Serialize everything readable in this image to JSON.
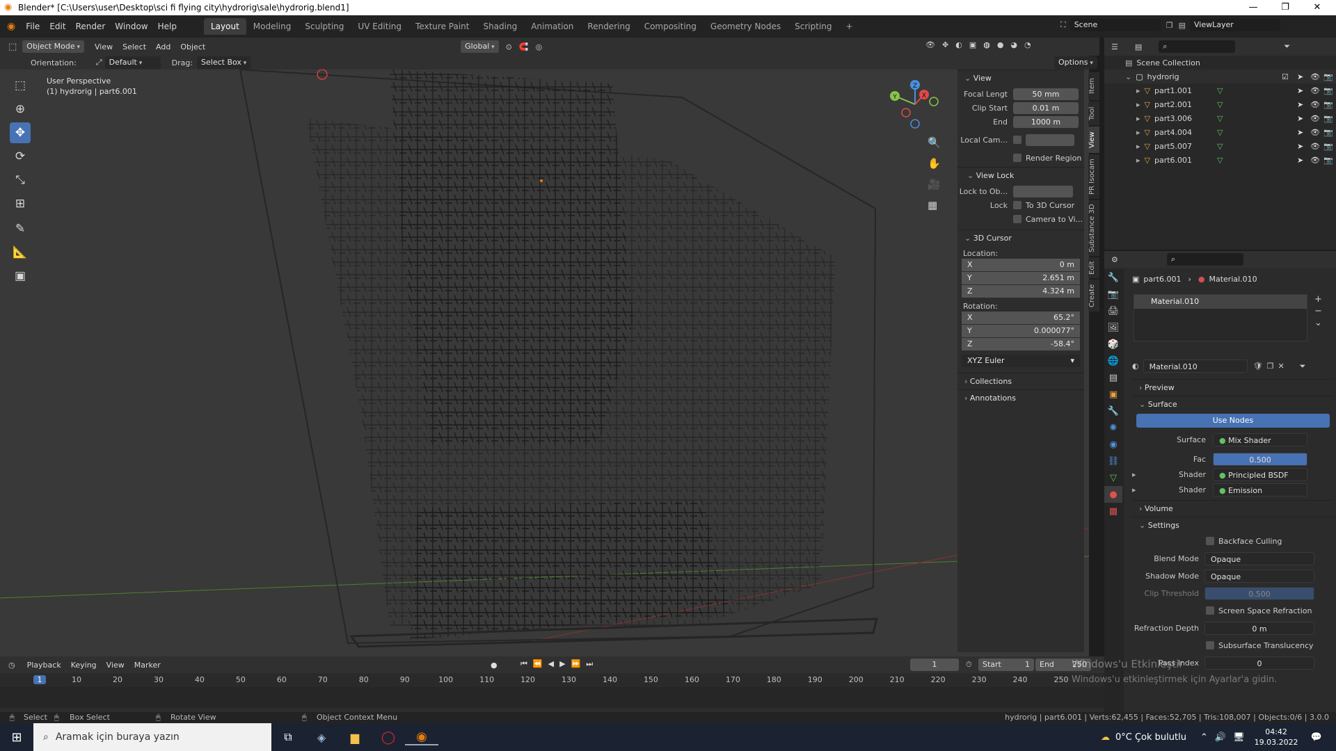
{
  "window": {
    "title": "Blender* [C:\\Users\\user\\Desktop\\sci fi flying city\\hydrorig\\sale\\hydrorig.blend1]",
    "minimize": "—",
    "maximize": "❐",
    "close": "✕"
  },
  "menus": [
    "File",
    "Edit",
    "Render",
    "Window",
    "Help"
  ],
  "workspaces": [
    "Layout",
    "Modeling",
    "Sculpting",
    "UV Editing",
    "Texture Paint",
    "Shading",
    "Animation",
    "Rendering",
    "Compositing",
    "Geometry Nodes",
    "Scripting"
  ],
  "workspace_active": "Layout",
  "scene_name": "Scene",
  "view_layer": "ViewLayer",
  "viewport_header": {
    "mode": "Object Mode",
    "menus": [
      "View",
      "Select",
      "Add",
      "Object"
    ],
    "transform": "Global",
    "orientation_label": "Orientation:",
    "orientation_value": "Default",
    "drag_label": "Drag:",
    "drag_value": "Select Box",
    "options": "Options"
  },
  "viewport": {
    "perspective": "User Perspective",
    "object_info": "(1) hydrorig | part6.001",
    "gizmo": {
      "x": "X",
      "y": "Y",
      "z": "Z"
    }
  },
  "npanel": {
    "view_title": "View",
    "focal_label": "Focal Lengt",
    "focal_value": "50 mm",
    "clip_start_label": "Clip Start",
    "clip_start_value": "0.01 m",
    "end_label": "End",
    "end_value": "1000 m",
    "local_cam_label": "Local Cam...",
    "render_region": "Render Region",
    "view_lock_title": "View Lock",
    "lock_to_obj_label": "Lock to Ob...",
    "lock_label": "Lock",
    "to_3d_cursor": "To 3D Cursor",
    "camera_to_view": "Camera to Vi...",
    "cursor_title": "3D Cursor",
    "location_label": "Location:",
    "loc_x": "0 m",
    "loc_y": "2.651 m",
    "loc_z": "4.324 m",
    "rotation_label": "Rotation:",
    "rot_x": "65.2°",
    "rot_y": "0.000077°",
    "rot_z": "-58.4°",
    "rot_mode": "XYZ Euler",
    "collections": "Collections",
    "annotations": "Annotations",
    "x": "X",
    "y": "Y",
    "z": "Z",
    "tabs": [
      "Item",
      "Tool",
      "View",
      "PR Isocam",
      "Substance 3D",
      "Edit",
      "Create"
    ]
  },
  "outliner": {
    "root": "Scene Collection",
    "collection": "hydrorig",
    "objects": [
      "part1.001",
      "part2.001",
      "part3.006",
      "part4.004",
      "part5.007",
      "part6.001"
    ]
  },
  "properties": {
    "breadcrumb_obj": "part6.001",
    "breadcrumb_mat": "Material.010",
    "slot": "Material.010",
    "material_name": "Material.010",
    "preview": "Preview",
    "surface": "Surface",
    "use_nodes": "Use Nodes",
    "surface_label": "Surface",
    "surface_value": "Mix Shader",
    "fac_label": "Fac",
    "fac_value": "0.500",
    "shader_label": "Shader",
    "shader1": "Principled BSDF",
    "shader2": "Emission",
    "volume": "Volume",
    "settings": "Settings",
    "backface": "Backface Culling",
    "blend_label": "Blend Mode",
    "blend_value": "Opaque",
    "shadow_label": "Shadow Mode",
    "shadow_value": "Opaque",
    "clip_label": "Clip Threshold",
    "clip_value": "0.500",
    "ssr": "Screen Space Refraction",
    "refr_label": "Refraction Depth",
    "refr_value": "0 m",
    "subsurface": "Subsurface Translucency",
    "pass_label": "Pass Index",
    "pass_value": "0"
  },
  "timeline": {
    "menus": [
      "Playback",
      "Keying",
      "View",
      "Marker"
    ],
    "current_frame": "1",
    "start_label": "Start",
    "start_value": "1",
    "end_label": "End",
    "end_value": "250",
    "ticks": [
      1,
      10,
      20,
      30,
      40,
      50,
      60,
      70,
      80,
      90,
      100,
      110,
      120,
      130,
      140,
      150,
      160,
      170,
      180,
      190,
      200,
      210,
      220,
      230,
      240,
      250
    ]
  },
  "watermark": {
    "line1": "Windows'u Etkinleştir",
    "line2": "Windows'u etkinleştirmek için Ayarlar'a gidin."
  },
  "statusbar": {
    "select": "Select",
    "box_select": "Box Select",
    "rotate_view": "Rotate View",
    "context_menu": "Object Context Menu",
    "stats": "hydrorig | part6.001 | Verts:62,455 | Faces:52,705 | Tris:108,007 | Objects:0/6 | 3.0.0"
  },
  "taskbar": {
    "search_placeholder": "Aramak için buraya yazın",
    "weather": "0°C  Çok bulutlu",
    "time": "04:42",
    "date": "19.03.2022"
  },
  "colors": {
    "accent": "#4772b3",
    "blender_orange": "#e87d0d",
    "axis_x": "#e04a4a",
    "axis_y": "#8bc34a",
    "axis_z": "#4a8fe0"
  }
}
